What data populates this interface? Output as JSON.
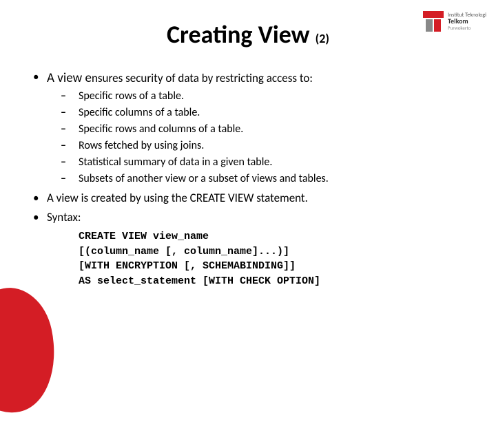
{
  "logo": {
    "line1": "Institut Teknologi",
    "line2": "Telkom",
    "line3": "Purwokerto"
  },
  "title": {
    "main": "Creating View",
    "sub": "(2)"
  },
  "bullets": {
    "b1_lead": "A view e",
    "b1_rest": "nsures security of data by restricting access to:",
    "sub": [
      "Specific rows of a table.",
      "Specific columns of a table.",
      "Specific rows and columns of a table.",
      "Rows fetched by using joins.",
      "Statistical summary of data in a given table.",
      "Subsets of another view or a subset of views and tables."
    ],
    "b2": "A view is created by using the CREATE VIEW statement.",
    "b3": "Syntax:"
  },
  "syntax": {
    "l1": "CREATE VIEW view_name",
    "l2": "[(column_name [, column_name]...)]",
    "l3": "[WITH ENCRYPTION [, SCHEMABINDING]]",
    "l4": "AS select_statement [WITH CHECK OPTION]"
  }
}
